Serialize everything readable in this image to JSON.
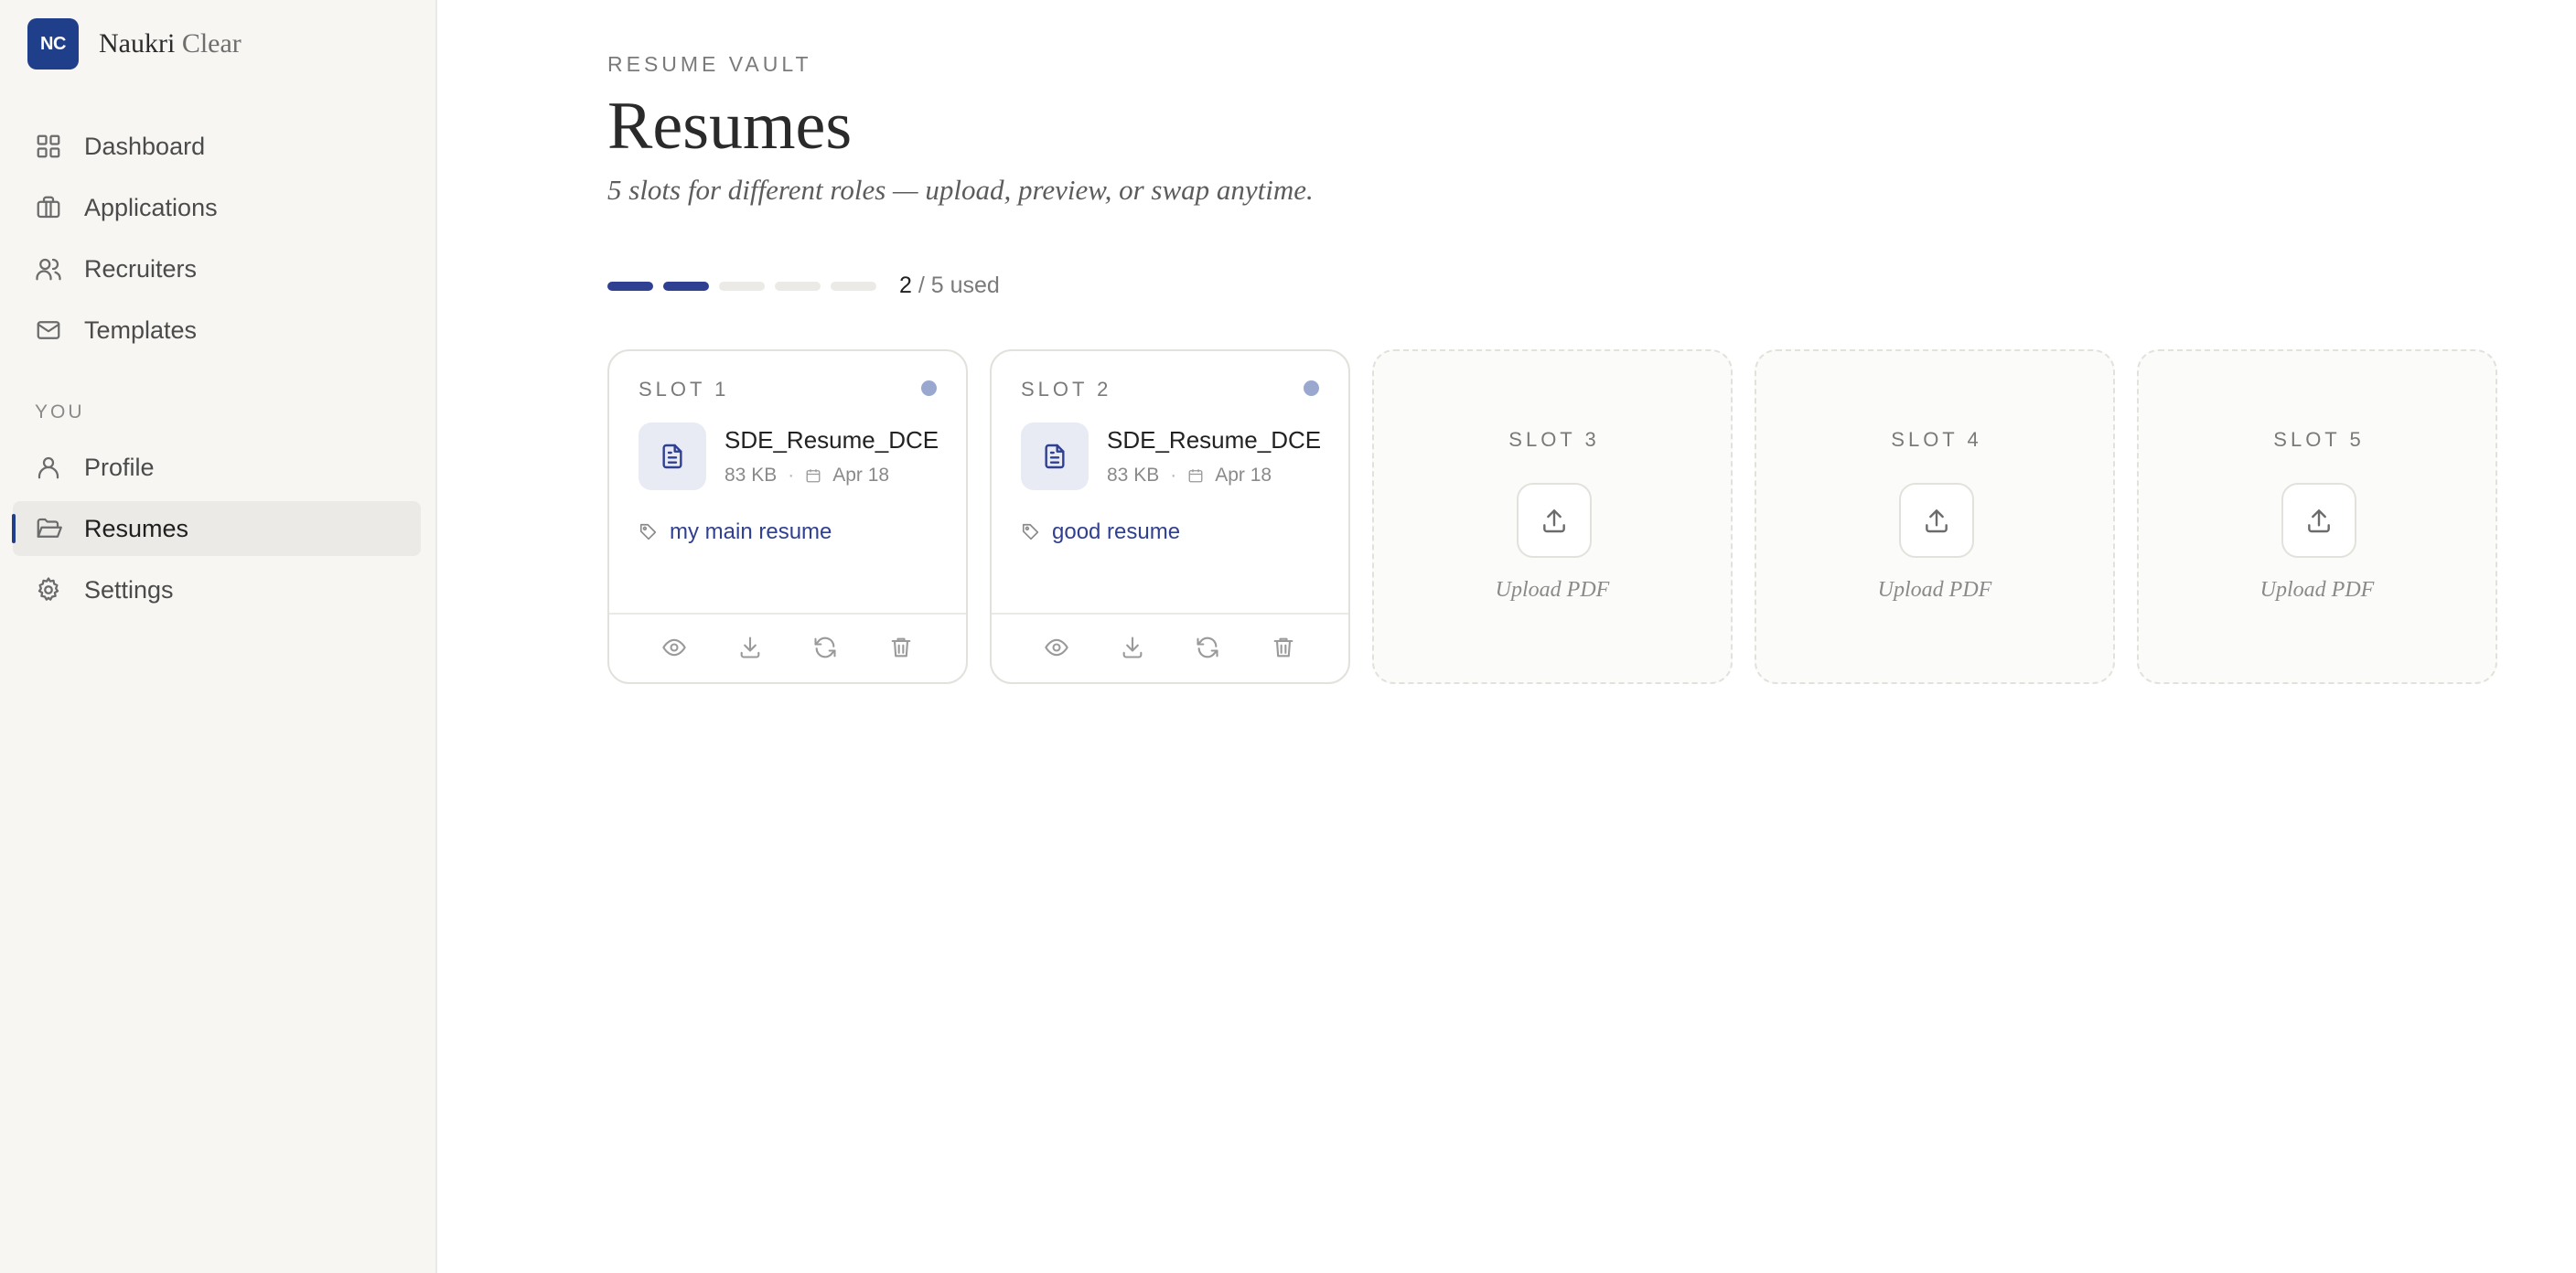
{
  "brand": {
    "logo_text": "NC",
    "name_main": "Naukri",
    "name_light": "Clear"
  },
  "sidebar": {
    "items": [
      {
        "label": "Dashboard",
        "icon": "grid-icon"
      },
      {
        "label": "Applications",
        "icon": "briefcase-icon"
      },
      {
        "label": "Recruiters",
        "icon": "users-icon"
      },
      {
        "label": "Templates",
        "icon": "mail-icon"
      }
    ],
    "section_label": "YOU",
    "you_items": [
      {
        "label": "Profile",
        "icon": "user-icon"
      },
      {
        "label": "Resumes",
        "icon": "folder-icon",
        "active": true
      },
      {
        "label": "Settings",
        "icon": "gear-icon"
      }
    ]
  },
  "header": {
    "eyebrow": "RESUME VAULT",
    "title": "Resumes",
    "subtitle": "5 slots for different roles — upload, preview, or swap anytime."
  },
  "usage": {
    "used": "2",
    "total_text": " / 5 used",
    "used_count": 2,
    "total_count": 5,
    "active_color": "#2f3f91"
  },
  "slots": [
    {
      "label": "SLOT 1",
      "file_name": "SDE_Resume_DCE.pdf",
      "size": "83 KB",
      "date": "Apr 18",
      "tag": "my main resume"
    },
    {
      "label": "SLOT 2",
      "file_name": "SDE_Resume_DCE.pdf",
      "size": "83 KB",
      "date": "Apr 18",
      "tag": "good resume"
    },
    {
      "label": "SLOT 3",
      "upload_label": "Upload PDF"
    },
    {
      "label": "SLOT 4",
      "upload_label": "Upload PDF"
    },
    {
      "label": "SLOT 5",
      "upload_label": "Upload PDF"
    }
  ]
}
